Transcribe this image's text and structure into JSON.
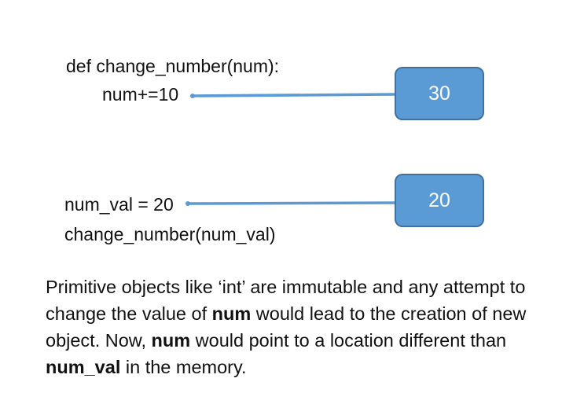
{
  "code": {
    "def_line": "def change_number(num):",
    "increment_line": "num+=10",
    "assign_line": "num_val = 20",
    "call_line": "change_number(num_val)"
  },
  "boxes": {
    "top_value": "30",
    "bottom_value": "20"
  },
  "explanation": {
    "part1": "Primitive objects like ‘int’ are immutable and any attempt to change the value of ",
    "bold1": "num",
    "part2": " would lead to the creation of new object. Now, ",
    "bold2": "num",
    "part3": " would point to a location different than ",
    "bold3": "num_val",
    "part4": " in the memory."
  },
  "colors": {
    "box_fill": "#5b9bd5",
    "box_border": "#41719c",
    "connector": "#5b9bd5"
  }
}
